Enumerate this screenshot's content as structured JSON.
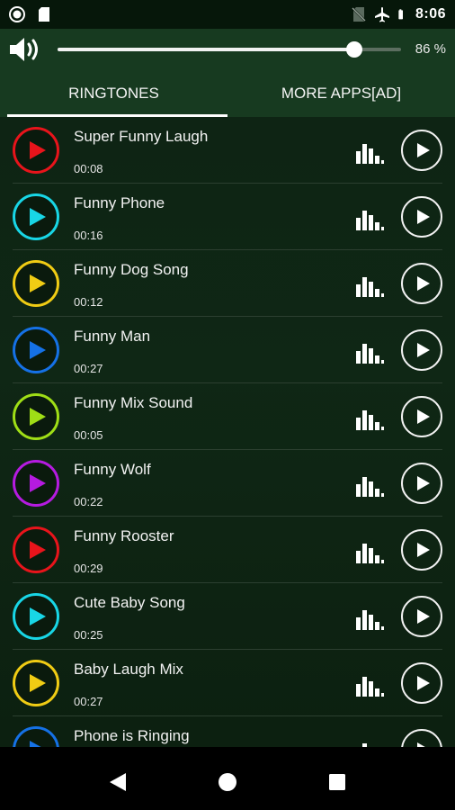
{
  "status_bar": {
    "time": "8:06",
    "icons": [
      "record-icon",
      "sd-card-icon",
      "no-sim-icon",
      "airplane-mode-icon",
      "battery-icon"
    ]
  },
  "volume": {
    "percent_text": "86 %",
    "level": 0.86,
    "icon": "speaker-volume-icon"
  },
  "tabs": [
    {
      "label": "RINGTONES",
      "active": true
    },
    {
      "label": "MORE APPS[AD]",
      "active": false
    }
  ],
  "ringtones": [
    {
      "title": "Super Funny Laugh",
      "duration": "00:08",
      "color": "#e8141b"
    },
    {
      "title": "Funny Phone",
      "duration": "00:16",
      "color": "#18d6e6"
    },
    {
      "title": "Funny Dog Song",
      "duration": "00:12",
      "color": "#f0cc14"
    },
    {
      "title": "Funny Man",
      "duration": "00:27",
      "color": "#1571e6"
    },
    {
      "title": "Funny Mix Sound",
      "duration": "00:05",
      "color": "#9fde16"
    },
    {
      "title": "Funny Wolf",
      "duration": "00:22",
      "color": "#b51be0"
    },
    {
      "title": "Funny Rooster",
      "duration": "00:29",
      "color": "#e8141b"
    },
    {
      "title": "Cute Baby Song",
      "duration": "00:25",
      "color": "#18d6e6"
    },
    {
      "title": "Baby Laugh Mix",
      "duration": "00:27",
      "color": "#f0cc14"
    },
    {
      "title": "Phone is Ringing",
      "duration": "",
      "color": "#1571e6"
    }
  ],
  "nav": {
    "back_icon": "back-triangle-icon",
    "home_icon": "home-circle-icon",
    "recents_icon": "recents-square-icon"
  }
}
